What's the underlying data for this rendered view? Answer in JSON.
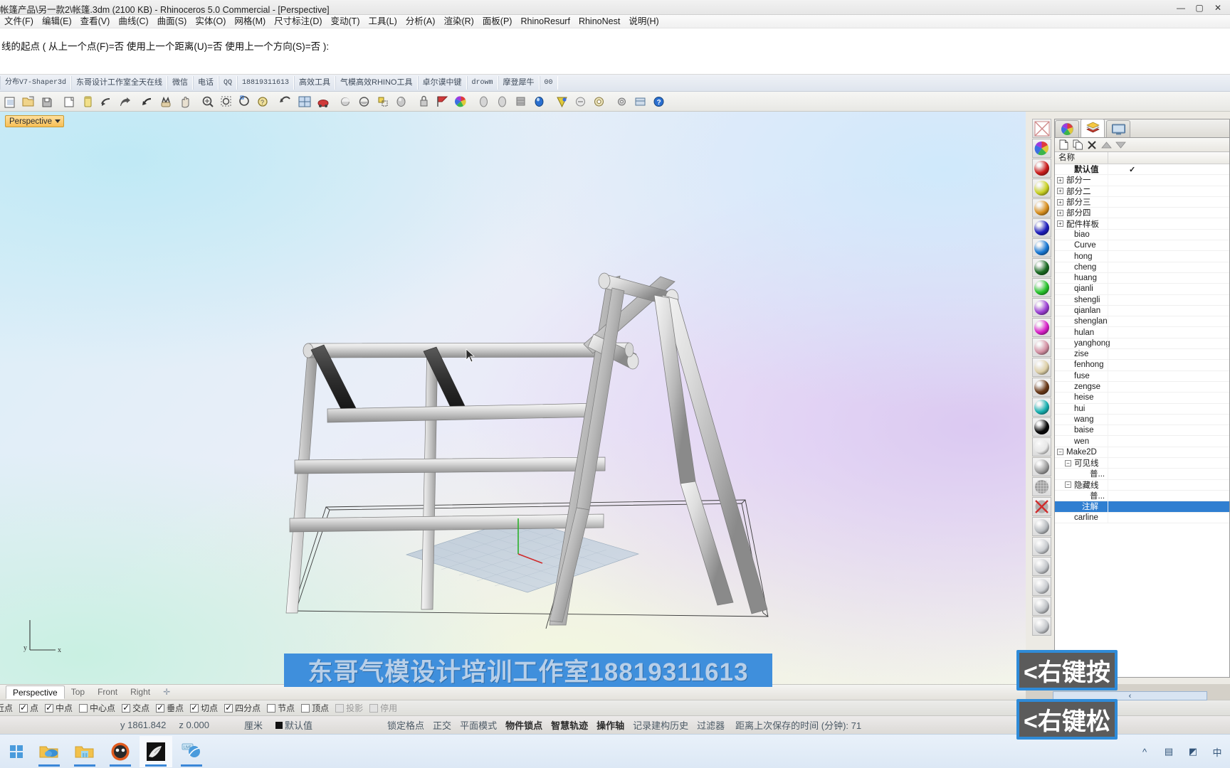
{
  "window": {
    "title": "帐篷产品\\另一款2\\帐篷.3dm (2100 KB) - Rhinoceros 5.0 Commercial - [Perspective]",
    "minimize": "—",
    "maximize": "▢",
    "close": "✕"
  },
  "menu": {
    "items": [
      {
        "label": "文件(F)"
      },
      {
        "label": "编辑(E)"
      },
      {
        "label": "查看(V)"
      },
      {
        "label": "曲线(C)"
      },
      {
        "label": "曲面(S)"
      },
      {
        "label": "实体(O)"
      },
      {
        "label": "网格(M)"
      },
      {
        "label": "尺寸标注(D)"
      },
      {
        "label": "变动(T)"
      },
      {
        "label": "工具(L)"
      },
      {
        "label": "分析(A)"
      },
      {
        "label": "渲染(R)"
      },
      {
        "label": "面板(P)"
      },
      {
        "label": "RhinoResurf"
      },
      {
        "label": "RhinoNest"
      },
      {
        "label": "说明(H)"
      }
    ]
  },
  "command": {
    "prompt": "线的起点 ( 从上一个点(F)=否  使用上一个距离(U)=否  使用上一个方向(S)=否 ):"
  },
  "text_toolbar": {
    "tabs": [
      {
        "label": "分布V7-Shaper3d",
        "mono": true
      },
      {
        "label": "东哥设计工作室全天在线",
        "mono": false
      },
      {
        "label": "微信",
        "mono": false
      },
      {
        "label": "电话",
        "mono": false
      },
      {
        "label": "QQ",
        "mono": true
      },
      {
        "label": "18819311613",
        "mono": true
      },
      {
        "label": "高效工具",
        "mono": false
      },
      {
        "label": "气模高效RHINO工具",
        "mono": false
      },
      {
        "label": "卓尔谟中键",
        "mono": false
      },
      {
        "label": "drowm",
        "mono": true
      },
      {
        "label": "摩登犀牛",
        "mono": false
      },
      {
        "label": "00",
        "mono": true
      }
    ]
  },
  "icon_toolbar": {
    "icons": [
      {
        "name": "new-file-icon"
      },
      {
        "name": "open-file-icon"
      },
      {
        "name": "save-file-icon"
      },
      {
        "name": "print-icon"
      },
      {
        "name": "cut-icon"
      },
      {
        "name": "copy-icon"
      },
      {
        "name": "paste-icon"
      },
      {
        "name": "undo-icon"
      },
      {
        "name": "redo-icon"
      },
      {
        "name": "pan-icon"
      },
      {
        "name": "zoom-window-icon"
      },
      {
        "name": "zoom-extents-icon"
      },
      {
        "name": "zoom-selected-icon"
      },
      {
        "name": "zoom-dynamic-icon"
      },
      {
        "name": "rotate-view-icon"
      },
      {
        "name": "undo-view-icon"
      },
      {
        "name": "four-view-icon"
      },
      {
        "name": "render-icon"
      },
      {
        "name": "shade-icon"
      },
      {
        "name": "ghosted-icon"
      },
      {
        "name": "layer-icon"
      },
      {
        "name": "light-icon"
      },
      {
        "name": "lock-icon"
      },
      {
        "name": "flag-icon"
      },
      {
        "name": "color-wheel-icon"
      },
      {
        "name": "sphere-icon"
      },
      {
        "name": "cylinder-icon"
      },
      {
        "name": "grid-icon"
      },
      {
        "name": "blue-sphere-icon"
      },
      {
        "name": "cone-icon"
      },
      {
        "name": "paint-icon"
      },
      {
        "name": "gear-icon"
      },
      {
        "name": "tools-icon"
      },
      {
        "name": "help-icon"
      }
    ]
  },
  "viewport": {
    "label": "Perspective",
    "axis_x": "x",
    "axis_y": "y",
    "watermark": "东哥气模设计培训工作室18819311613",
    "watermark_bg": "#3f8fdc"
  },
  "right_panel": {
    "tabs": [
      {
        "name": "material-tab",
        "icon": "color-wheel-icon",
        "active": false
      },
      {
        "name": "layers-tab",
        "icon": "layers-icon",
        "active": true
      },
      {
        "name": "display-tab",
        "icon": "monitor-icon",
        "active": false
      }
    ],
    "buttons": [
      {
        "name": "new-layer-button",
        "icon": "page-icon"
      },
      {
        "name": "duplicate-layer-button",
        "icon": "copy-icon"
      },
      {
        "name": "delete-layer-button",
        "icon": "x-icon"
      },
      {
        "name": "move-up-button",
        "icon": "up-triangle-icon"
      },
      {
        "name": "move-down-button",
        "icon": "down-triangle-icon"
      }
    ],
    "column_header": "名称",
    "layers": [
      {
        "label": "默认值",
        "indent": 1,
        "expander": "",
        "bold": true,
        "current": true,
        "selected": false
      },
      {
        "label": "部分一",
        "indent": 0,
        "expander": "+",
        "bold": false,
        "current": false,
        "selected": false
      },
      {
        "label": "部分二",
        "indent": 0,
        "expander": "+",
        "bold": false,
        "current": false,
        "selected": false
      },
      {
        "label": "部分三",
        "indent": 0,
        "expander": "+",
        "bold": false,
        "current": false,
        "selected": false
      },
      {
        "label": "部分四",
        "indent": 0,
        "expander": "+",
        "bold": false,
        "current": false,
        "selected": false
      },
      {
        "label": "配件样板",
        "indent": 0,
        "expander": "+",
        "bold": false,
        "current": false,
        "selected": false
      },
      {
        "label": "biao",
        "indent": 1,
        "expander": "",
        "bold": false,
        "current": false,
        "selected": false
      },
      {
        "label": "Curve",
        "indent": 1,
        "expander": "",
        "bold": false,
        "current": false,
        "selected": false
      },
      {
        "label": "hong",
        "indent": 1,
        "expander": "",
        "bold": false,
        "current": false,
        "selected": false
      },
      {
        "label": "cheng",
        "indent": 1,
        "expander": "",
        "bold": false,
        "current": false,
        "selected": false
      },
      {
        "label": "huang",
        "indent": 1,
        "expander": "",
        "bold": false,
        "current": false,
        "selected": false
      },
      {
        "label": "qianli",
        "indent": 1,
        "expander": "",
        "bold": false,
        "current": false,
        "selected": false
      },
      {
        "label": "shengli",
        "indent": 1,
        "expander": "",
        "bold": false,
        "current": false,
        "selected": false
      },
      {
        "label": "qianlan",
        "indent": 1,
        "expander": "",
        "bold": false,
        "current": false,
        "selected": false
      },
      {
        "label": "shenglan",
        "indent": 1,
        "expander": "",
        "bold": false,
        "current": false,
        "selected": false
      },
      {
        "label": "hulan",
        "indent": 1,
        "expander": "",
        "bold": false,
        "current": false,
        "selected": false
      },
      {
        "label": "yanghong",
        "indent": 1,
        "expander": "",
        "bold": false,
        "current": false,
        "selected": false
      },
      {
        "label": "zise",
        "indent": 1,
        "expander": "",
        "bold": false,
        "current": false,
        "selected": false
      },
      {
        "label": "fenhong",
        "indent": 1,
        "expander": "",
        "bold": false,
        "current": false,
        "selected": false
      },
      {
        "label": "fuse",
        "indent": 1,
        "expander": "",
        "bold": false,
        "current": false,
        "selected": false
      },
      {
        "label": "zengse",
        "indent": 1,
        "expander": "",
        "bold": false,
        "current": false,
        "selected": false
      },
      {
        "label": "heise",
        "indent": 1,
        "expander": "",
        "bold": false,
        "current": false,
        "selected": false
      },
      {
        "label": "hui",
        "indent": 1,
        "expander": "",
        "bold": false,
        "current": false,
        "selected": false
      },
      {
        "label": "wang",
        "indent": 1,
        "expander": "",
        "bold": false,
        "current": false,
        "selected": false
      },
      {
        "label": "baise",
        "indent": 1,
        "expander": "",
        "bold": false,
        "current": false,
        "selected": false
      },
      {
        "label": "wen",
        "indent": 1,
        "expander": "",
        "bold": false,
        "current": false,
        "selected": false
      },
      {
        "label": "Make2D",
        "indent": 0,
        "expander": "−",
        "bold": false,
        "current": false,
        "selected": false
      },
      {
        "label": "可见线",
        "indent": 1,
        "expander": "−",
        "bold": false,
        "current": false,
        "selected": false
      },
      {
        "label": "普...",
        "indent": 3,
        "expander": "",
        "bold": false,
        "current": false,
        "selected": false
      },
      {
        "label": "隐藏线",
        "indent": 1,
        "expander": "−",
        "bold": false,
        "current": false,
        "selected": false
      },
      {
        "label": "普...",
        "indent": 3,
        "expander": "",
        "bold": false,
        "current": false,
        "selected": false
      },
      {
        "label": "注解",
        "indent": 2,
        "expander": "",
        "bold": false,
        "current": false,
        "selected": true
      },
      {
        "label": "carline",
        "indent": 1,
        "expander": "",
        "bold": false,
        "current": false,
        "selected": false
      }
    ],
    "material_swatches": [
      {
        "name": "no-material-swatch",
        "color": "none"
      },
      {
        "name": "color-wheel-swatch",
        "color": "wheel"
      },
      {
        "name": "red-swatch",
        "color": "#cc1c1c"
      },
      {
        "name": "yellow-green-swatch",
        "color": "#c9d124"
      },
      {
        "name": "orange-swatch",
        "color": "#d9901f"
      },
      {
        "name": "dark-blue-swatch",
        "color": "#1e1ebe"
      },
      {
        "name": "blue-swatch",
        "color": "#1878d4"
      },
      {
        "name": "dark-green-swatch",
        "color": "#1a6b22"
      },
      {
        "name": "green-swatch",
        "color": "#28c42c"
      },
      {
        "name": "purple-swatch",
        "color": "#9c3fd4"
      },
      {
        "name": "magenta-swatch",
        "color": "#d921c9"
      },
      {
        "name": "pink-swatch",
        "color": "#d490a3"
      },
      {
        "name": "cream-swatch",
        "color": "#ddcfa6"
      },
      {
        "name": "brown-swatch",
        "color": "#6b3a18"
      },
      {
        "name": "teal-swatch",
        "color": "#18b0b0"
      },
      {
        "name": "black-swatch",
        "color": "#0a0a0a"
      },
      {
        "name": "white-swatch",
        "color": "#e8e8e8"
      },
      {
        "name": "grey-swatch",
        "color": "#9f9f9f"
      },
      {
        "name": "mesh-swatch",
        "color": "mesh"
      },
      {
        "name": "disabled-swatch",
        "color": "disabled"
      },
      {
        "name": "glass-swatch-1",
        "color": "#b8bcc0"
      },
      {
        "name": "glass-swatch-2",
        "color": "#c9ccd0"
      },
      {
        "name": "glass-swatch-3",
        "color": "#c4c7cb"
      },
      {
        "name": "glass-swatch-4",
        "color": "#cacdd1"
      },
      {
        "name": "glass-swatch-5",
        "color": "#c0c3c7"
      },
      {
        "name": "glass-swatch-6",
        "color": "#c6c9cd"
      }
    ]
  },
  "view_tabs": {
    "items": [
      {
        "label": "Perspective",
        "active": true
      },
      {
        "label": "Top",
        "active": false
      },
      {
        "label": "Front",
        "active": false
      },
      {
        "label": "Right",
        "active": false
      }
    ],
    "add_label": "✛"
  },
  "snap_bar": {
    "items": [
      {
        "label": "最近点",
        "state": "unchecked",
        "truncated": true
      },
      {
        "label": "点",
        "state": "checked"
      },
      {
        "label": "中点",
        "state": "checked"
      },
      {
        "label": "中心点",
        "state": "unchecked"
      },
      {
        "label": "交点",
        "state": "checked"
      },
      {
        "label": "垂点",
        "state": "checked"
      },
      {
        "label": "切点",
        "state": "checked"
      },
      {
        "label": "四分点",
        "state": "checked"
      },
      {
        "label": "节点",
        "state": "unchecked"
      },
      {
        "label": "顶点",
        "state": "unchecked"
      },
      {
        "label": "投影",
        "state": "disabled"
      },
      {
        "label": "停用",
        "state": "disabled"
      }
    ]
  },
  "status_bar": {
    "coord_y": "y 1861.842",
    "coord_z": "z 0.000",
    "units": "厘米",
    "layer": "默认值",
    "toggles": [
      {
        "label": "锁定格点",
        "active": false
      },
      {
        "label": "正交",
        "active": false
      },
      {
        "label": "平面模式",
        "active": false
      },
      {
        "label": "物件锁点",
        "active": true
      },
      {
        "label": "智慧轨迹",
        "active": true
      },
      {
        "label": "操作轴",
        "active": true
      },
      {
        "label": "记录建构历史",
        "active": false
      },
      {
        "label": "过滤器",
        "active": false
      }
    ],
    "autosave": "距离上次保存的时间 (分钟): 71"
  },
  "callouts": [
    {
      "name": "right-click-press-callout",
      "text": "<右键按"
    },
    {
      "name": "right-click-release-callout",
      "text": "<右键松"
    }
  ],
  "scroll_hint": "‹",
  "taskbar": {
    "items": [
      {
        "name": "onedrive-taskbar-icon",
        "active": false
      },
      {
        "name": "file-explorer-taskbar-icon",
        "active": false
      },
      {
        "name": "browser-taskbar-icon",
        "active": false
      },
      {
        "name": "rhino-taskbar-icon",
        "active": true
      },
      {
        "name": "chat-taskbar-icon",
        "active": false
      }
    ],
    "tray": [
      {
        "name": "tray-chevron-icon",
        "glyph": "^"
      },
      {
        "name": "tray-network-icon",
        "glyph": "▤"
      },
      {
        "name": "tray-volume-icon",
        "glyph": "◩"
      },
      {
        "name": "tray-ime-icon",
        "glyph": "中"
      }
    ]
  }
}
